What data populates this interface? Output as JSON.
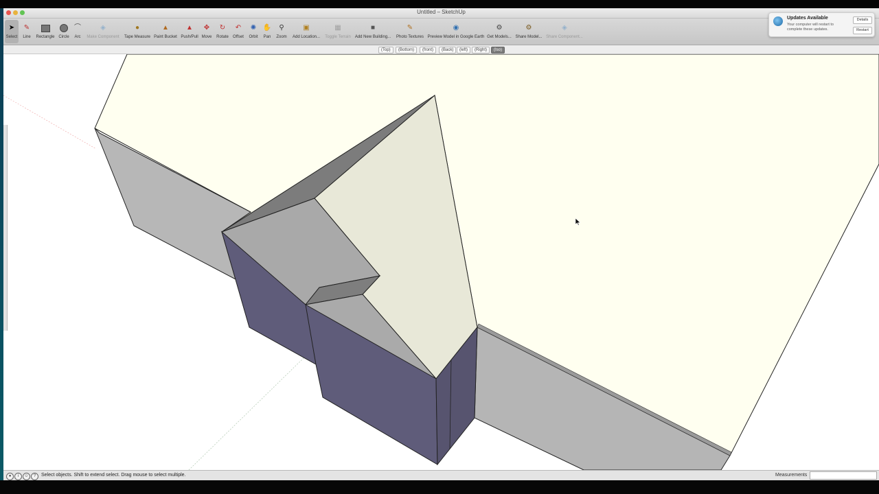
{
  "window": {
    "title": "Untitled – SketchUp"
  },
  "toolbar": {
    "tools": [
      {
        "label": "Select",
        "icon": "arrow-cursor-icon"
      },
      {
        "label": "Line",
        "icon": "pencil-icon"
      },
      {
        "label": "Rectangle",
        "icon": "rectangle-icon"
      },
      {
        "label": "Circle",
        "icon": "circle-icon"
      },
      {
        "label": "Arc",
        "icon": "arc-icon"
      },
      {
        "label": "Make Component",
        "icon": "component-icon"
      },
      {
        "label": "Tape Measure",
        "icon": "tape-measure-icon"
      },
      {
        "label": "Paint Bucket",
        "icon": "paint-bucket-icon"
      },
      {
        "label": "Push/Pull",
        "icon": "push-pull-icon"
      },
      {
        "label": "Move",
        "icon": "move-icon"
      },
      {
        "label": "Rotate",
        "icon": "rotate-icon"
      },
      {
        "label": "Offset",
        "icon": "offset-icon"
      },
      {
        "label": "Orbit",
        "icon": "orbit-icon"
      },
      {
        "label": "Pan",
        "icon": "pan-hand-icon"
      },
      {
        "label": "Zoom",
        "icon": "magnifier-icon"
      },
      {
        "label": "Add Location...",
        "icon": "add-location-icon"
      },
      {
        "label": "Toggle Terrain",
        "icon": "terrain-icon"
      },
      {
        "label": "Add New Building...",
        "icon": "building-icon"
      },
      {
        "label": "Photo Textures",
        "icon": "photo-texture-icon"
      },
      {
        "label": "Preview Model in Google Earth",
        "icon": "google-earth-icon"
      },
      {
        "label": "Get Models...",
        "icon": "get-models-icon"
      },
      {
        "label": "Share Model...",
        "icon": "share-model-icon"
      },
      {
        "label": "Share Component...",
        "icon": "share-component-icon"
      }
    ]
  },
  "views": {
    "buttons": [
      "(Top)",
      "(Bottom)",
      "(front)",
      "(Back)",
      "(left)",
      "(Right)",
      "(Iso)"
    ],
    "selected": "(Iso)"
  },
  "status": {
    "text": "Select objects. Shift to extend select. Drag mouse to select multiple."
  },
  "measurements": {
    "label": "Measurements",
    "value": ""
  },
  "notification": {
    "title": "Updates Available",
    "body": "Your computer will restart to complete these updates.",
    "details_label": "Details",
    "restart_label": "Restart"
  },
  "colors": {
    "top_face": "#fffff0",
    "side_face": "#b5b5b5",
    "back_face": "#5f5c7a",
    "accent": "#1e6aa8"
  }
}
